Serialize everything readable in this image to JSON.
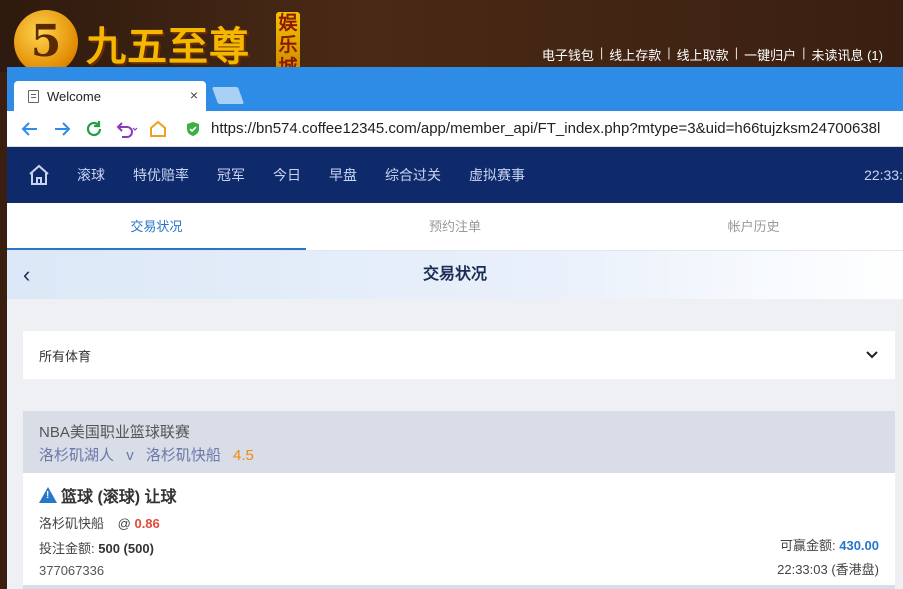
{
  "site": {
    "logo_digit": "5",
    "logo_text": "九五至尊",
    "logo_vertical": "娱乐城",
    "top_links": [
      "电子钱包",
      "线上存款",
      "线上取款",
      "一键归户",
      "未读讯息 (1)"
    ]
  },
  "browser": {
    "tab_title": "Welcome",
    "url": "https://bn574.coffee12345.com/app/member_api/FT_index.php?mtype=3&uid=h66tujzksm24700638l"
  },
  "appnav": {
    "items": [
      "滚球",
      "特优赔率",
      "冠军",
      "今日",
      "早盘",
      "综合过关",
      "虚拟赛事"
    ],
    "clock": "22:33:"
  },
  "subtabs": [
    "交易状况",
    "预约注单",
    "帐户历史"
  ],
  "page_title": "交易状况",
  "filter": {
    "selected": "所有体育"
  },
  "league": {
    "name": "NBA美国职业篮球联赛",
    "home": "洛杉矶湖人",
    "vs": "v",
    "away": "洛杉矶快船",
    "handicap": "4.5"
  },
  "bet": {
    "type": "篮球 (滚球) 让球",
    "pick": "洛杉矶快船",
    "at": "@",
    "odds": "0.86",
    "stake_label": "投注金额:",
    "stake": "500 (500)",
    "win_label": "可赢金额:",
    "win": "430.00",
    "id": "377067336",
    "time": "22:33:03 (香港盘)"
  }
}
